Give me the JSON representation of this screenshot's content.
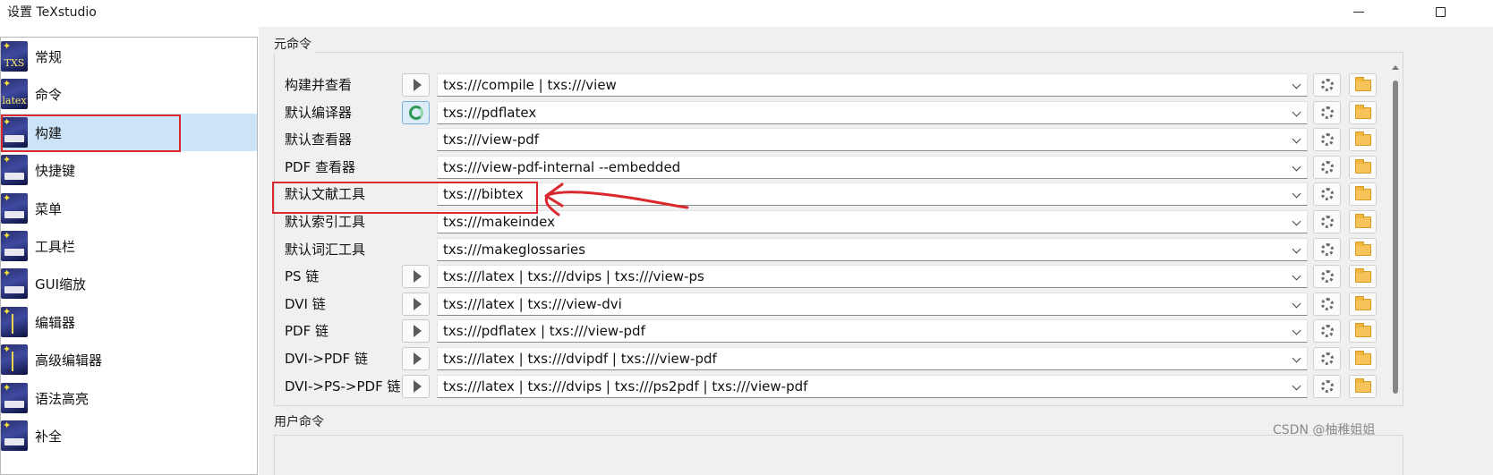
{
  "window": {
    "title": "设置 TeXstudio"
  },
  "sidebar": {
    "items": [
      {
        "label": "常规",
        "icon": "txs-logo-icon",
        "glyph": "TXS"
      },
      {
        "label": "命令",
        "icon": "latex-icon",
        "glyph": "latex"
      },
      {
        "label": "构建",
        "icon": "build-icon",
        "selected": true
      },
      {
        "label": "快捷键",
        "icon": "keyboard-icon"
      },
      {
        "label": "菜单",
        "icon": "menu-icon"
      },
      {
        "label": "工具栏",
        "icon": "toolbar-icon"
      },
      {
        "label": "GUI缩放",
        "icon": "gui-scale-icon"
      },
      {
        "label": "编辑器",
        "icon": "editor-icon"
      },
      {
        "label": "高级编辑器",
        "icon": "advanced-editor-icon"
      },
      {
        "label": "语法高亮",
        "icon": "syntax-highlight-icon"
      },
      {
        "label": "补全",
        "icon": "completion-icon"
      }
    ]
  },
  "meta_commands": {
    "group_title": "元命令",
    "rows": [
      {
        "label": "构建并查看",
        "value": "txs:///compile | txs:///view",
        "run_button": true
      },
      {
        "label": "默认编译器",
        "value": "txs:///pdflatex",
        "run_button": true,
        "run_active": true
      },
      {
        "label": "默认查看器",
        "value": "txs:///view-pdf",
        "run_button": false
      },
      {
        "label": "PDF 查看器",
        "value": "txs:///view-pdf-internal --embedded",
        "run_button": false
      },
      {
        "label": "默认文献工具",
        "value": "txs:///bibtex",
        "run_button": false
      },
      {
        "label": "默认索引工具",
        "value": "txs:///makeindex",
        "run_button": false
      },
      {
        "label": "默认词汇工具",
        "value": "txs:///makeglossaries",
        "run_button": false
      },
      {
        "label": "PS 链",
        "value": "txs:///latex | txs:///dvips | txs:///view-ps",
        "run_button": true
      },
      {
        "label": "DVI 链",
        "value": "txs:///latex | txs:///view-dvi",
        "run_button": true
      },
      {
        "label": "PDF 链",
        "value": "txs:///pdflatex | txs:///view-pdf",
        "run_button": true
      },
      {
        "label": "DVI->PDF 链",
        "value": "txs:///latex | txs:///dvipdf | txs:///view-pdf",
        "run_button": true
      },
      {
        "label": "DVI->PS->PDF 链",
        "value": "txs:///latex | txs:///dvips | txs:///ps2pdf | txs:///view-pdf",
        "run_button": true
      }
    ]
  },
  "user_commands": {
    "group_title": "用户命令"
  },
  "watermark": "CSDN @柚稚姐姐",
  "colors": {
    "selected_bg": "#cce4f7",
    "annotation_red": "#d9282e"
  }
}
